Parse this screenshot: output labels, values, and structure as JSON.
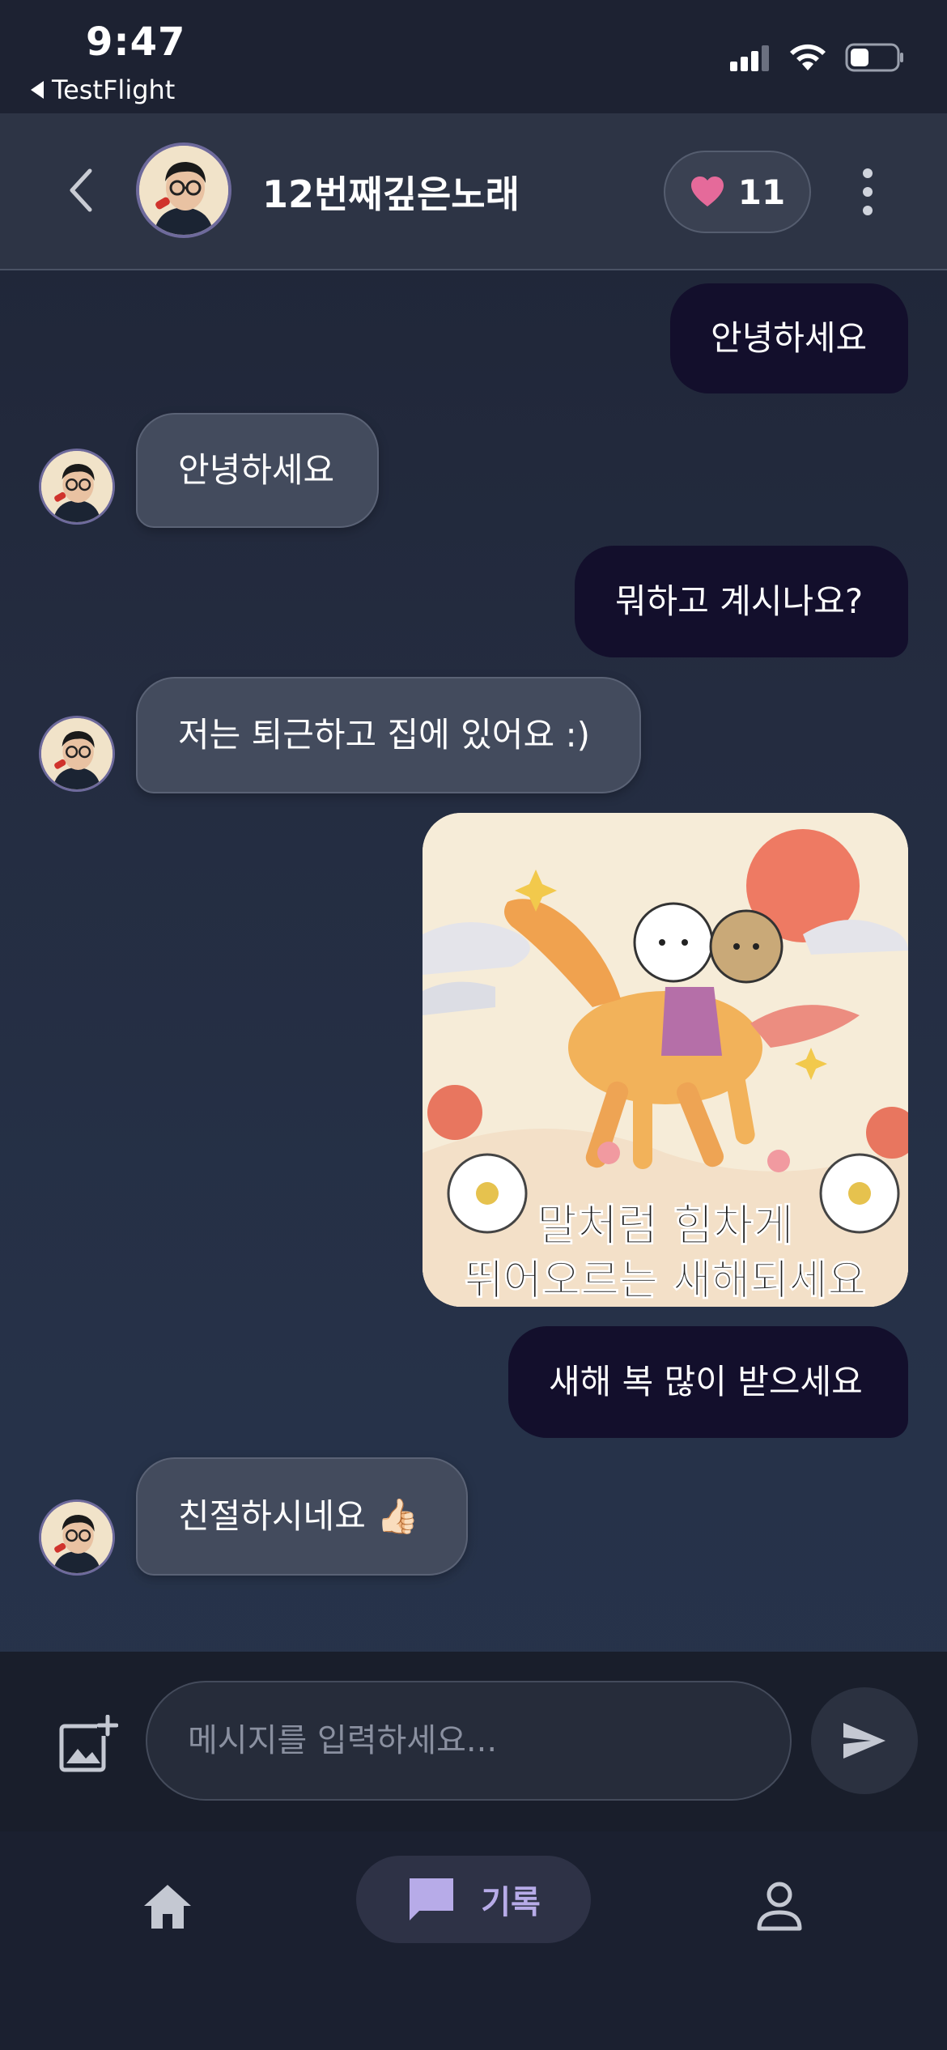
{
  "status_bar": {
    "time": "9:47",
    "back_app_label": "TestFlight",
    "icons": [
      "cellular-signal-icon",
      "wifi-icon",
      "battery-icon"
    ]
  },
  "header": {
    "title": "12번째깊은노래",
    "like_count": "11",
    "icons": [
      "back-chevron-icon",
      "heart-icon",
      "more-vertical-icon"
    ]
  },
  "messages": [
    {
      "direction": "out",
      "text": "안녕하세요"
    },
    {
      "direction": "in",
      "text": "안녕하세요"
    },
    {
      "direction": "out",
      "text": "뭐하고 계시나요?"
    },
    {
      "direction": "in",
      "text": "저는 퇴근하고 집에 있어요 :)"
    },
    {
      "direction": "out",
      "type": "image",
      "caption_line1": "말처럼 힘차게",
      "caption_line2": "뛰어오르는 새해되세요"
    },
    {
      "direction": "out",
      "text": "새해 복 많이 받으세요"
    },
    {
      "direction": "in",
      "text": "친절하시네요 👍🏻"
    }
  ],
  "composer": {
    "placeholder": "메시지를 입력하세요...",
    "icons": [
      "add-photo-icon",
      "send-icon"
    ]
  },
  "bottom_nav": {
    "items": [
      {
        "icon": "home-icon",
        "label": ""
      },
      {
        "icon": "chat-bubble-icon",
        "label": "기록",
        "active": true
      },
      {
        "icon": "person-icon",
        "label": ""
      }
    ]
  },
  "colors": {
    "accent": "#b7abe8",
    "outgoing_bubble": "#130f2c",
    "incoming_bubble": "#434b5d",
    "heart": "#e56a9a"
  }
}
